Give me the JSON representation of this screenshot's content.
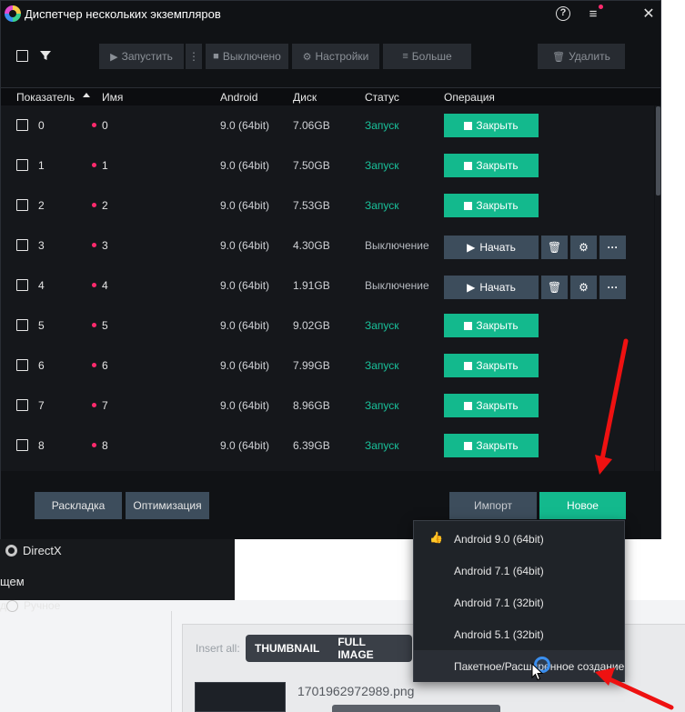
{
  "window": {
    "title": "Диспетчер нескольких экземпляров",
    "help_icon": "question-icon",
    "menu_icon": "hamburger-icon",
    "close_icon": "close-icon"
  },
  "toolbar": {
    "launch": "Запустить",
    "off": "Выключено",
    "settings": "Настройки",
    "more": "Больше",
    "delete": "Удалить"
  },
  "table": {
    "headers": {
      "index": "Показатель",
      "name": "Имя",
      "android": "Android",
      "disk": "Диск",
      "status": "Статус",
      "operation": "Операция"
    },
    "rows": [
      {
        "index": "0",
        "name": "0",
        "android": "9.0 (64bit)",
        "disk": "7.06GB",
        "status": "Запуск",
        "running": true
      },
      {
        "index": "1",
        "name": "1",
        "android": "9.0 (64bit)",
        "disk": "7.50GB",
        "status": "Запуск",
        "running": true
      },
      {
        "index": "2",
        "name": "2",
        "android": "9.0 (64bit)",
        "disk": "7.53GB",
        "status": "Запуск",
        "running": true
      },
      {
        "index": "3",
        "name": "3",
        "android": "9.0 (64bit)",
        "disk": "4.30GB",
        "status": "Выключение",
        "running": false
      },
      {
        "index": "4",
        "name": "4",
        "android": "9.0 (64bit)",
        "disk": "1.91GB",
        "status": "Выключение",
        "running": false
      },
      {
        "index": "5",
        "name": "5",
        "android": "9.0 (64bit)",
        "disk": "9.02GB",
        "status": "Запуск",
        "running": true
      },
      {
        "index": "6",
        "name": "6",
        "android": "9.0 (64bit)",
        "disk": "7.99GB",
        "status": "Запуск",
        "running": true
      },
      {
        "index": "7",
        "name": "7",
        "android": "9.0 (64bit)",
        "disk": "8.96GB",
        "status": "Запуск",
        "running": true
      },
      {
        "index": "8",
        "name": "8",
        "android": "9.0 (64bit)",
        "disk": "6.39GB",
        "status": "Запуск",
        "running": true
      }
    ],
    "close_label": "Закрыть",
    "start_label": "Начать"
  },
  "bottom": {
    "layout": "Раскладка",
    "optimize": "Оптимизация",
    "import": "Импорт",
    "new": "Новое"
  },
  "dropdown": {
    "items": [
      "Android 9.0 (64bit)",
      "Android 7.1 (64bit)",
      "Android 7.1 (32bit)",
      "Android 5.1 (32bit)",
      "Пакетное/Расширенное создание"
    ]
  },
  "background": {
    "directx": "DirectX",
    "general": "щем",
    "manual_prefix": "д",
    "manual": "Ручное",
    "insert_all": "Insert all:",
    "thumbnail": "THUMBNAIL",
    "full_image": "FULL IMAGE",
    "filename": "1701962972989.png"
  },
  "colors": {
    "accent_green": "#13b98d",
    "status_green": "#19c09a",
    "pink_dot": "#ff2a6d",
    "button_slate": "#3d4d5c",
    "annotation_red": "#ee1111"
  }
}
